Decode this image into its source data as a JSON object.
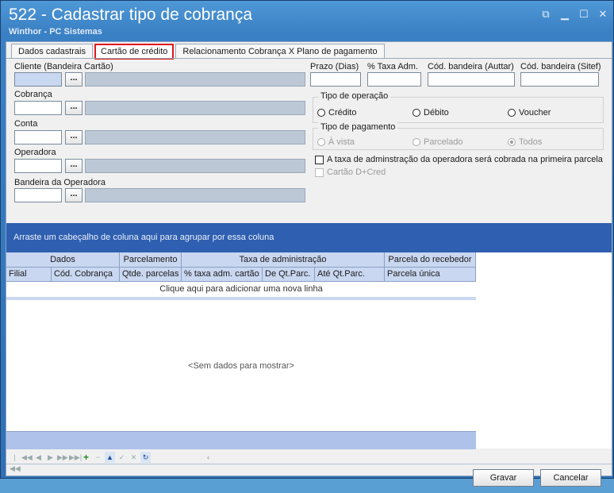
{
  "window": {
    "title": "522 - Cadastrar tipo de cobrança",
    "subtitle": "Winthor - PC Sistemas",
    "controls": [
      "restore-icon",
      "minimize-icon",
      "maximize-icon",
      "close-icon"
    ]
  },
  "tabs": [
    {
      "label": "Dados cadastrais"
    },
    {
      "label": "Cartão de crédito"
    },
    {
      "label": "Relacionamento Cobrança X Plano de pagamento"
    }
  ],
  "form": {
    "cliente_label": "Cliente (Bandeira Cartão)",
    "cobranca_label": "Cobrança",
    "conta_label": "Conta",
    "operadora_label": "Operadora",
    "bandeira_operadora_label": "Bandeira da Operadora",
    "ellipsis": "...",
    "prazo_label": "Prazo (Dias)",
    "taxa_label": "% Taxa Adm.",
    "cod_auttar_label": "Cód. bandeira (Auttar)",
    "cod_sitef_label": "Cód. bandeira (Sitef)"
  },
  "tipo_operacao": {
    "title": "Tipo de operação",
    "options": [
      "Crédito",
      "Débito",
      "Voucher"
    ]
  },
  "tipo_pagamento": {
    "title": "Tipo de pagamento",
    "options": [
      "À vista",
      "Parcelado",
      "Todos"
    ],
    "selected": "Todos"
  },
  "checks": {
    "taxa_primeira": "A taxa de adminstração da operadora será cobrada na primeira parcela",
    "cartao_dcred": "Cartão D+Cred"
  },
  "grid": {
    "group_hint": "Arraste um cabeçalho de coluna aqui para agrupar por essa coluna",
    "bands": [
      "Dados",
      "Parcelamento",
      "Taxa de administração",
      "Parcela do recebedor"
    ],
    "columns": [
      "Filial",
      "Cód. Cobrança",
      "Qtde. parcelas",
      "% taxa adm. cartão",
      "De Qt.Parc.",
      "Até Qt.Parc.",
      "Parcela única"
    ],
    "new_row": "Clique aqui para adicionar uma nova linha",
    "no_data": "<Sem dados para mostrar>"
  },
  "buttons": {
    "gravar": "Gravar",
    "cancelar": "Cancelar"
  },
  "colors": {
    "titlebar": "#3a80c4",
    "group_header": "#2f5fb0",
    "column_header": "#c9d7f0",
    "active_tab_border": "#e0191c"
  }
}
